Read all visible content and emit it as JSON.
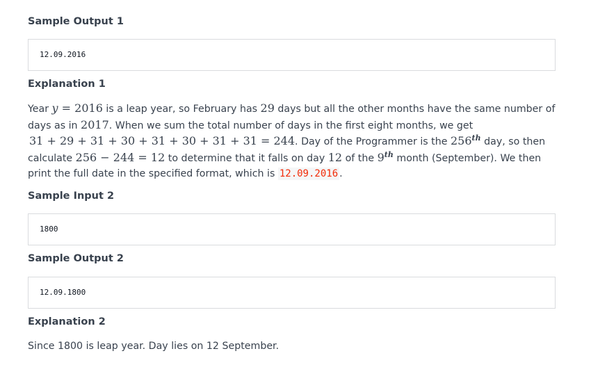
{
  "sample_output_1": {
    "heading": "Sample Output 1",
    "value": "12.09.2016"
  },
  "explanation_1": {
    "heading": "Explanation 1",
    "t1": "Year ",
    "m_y": "y",
    "m_eq2016": " = 2016",
    "t2": " is a leap year, so February has ",
    "m_29": "29",
    "t3": " days but all the other months have the same number of days as in ",
    "m_2017": "2017",
    "t4": ". When we sum the total number of days in the first eight months, we get ",
    "m_sum": "31 + 29 + 31 + 30 + 31 + 30 + 31 + 31 = 244",
    "t5": ". Day of the Programmer is the ",
    "m_256": "256",
    "m_th1": "th",
    "t6": " day, so then calculate ",
    "m_diff": "256 − 244 = 12",
    "t7": " to determine that it falls on day ",
    "m_12": "12",
    "t8": " of the ",
    "m_9": "9",
    "m_th2": "th",
    "t9": " month (September). We then print the full date in the specified format, which is ",
    "highlight": "12.09.2016",
    "t10": "."
  },
  "sample_input_2": {
    "heading": "Sample Input 2",
    "value": "1800"
  },
  "sample_output_2": {
    "heading": "Sample Output 2",
    "value": "12.09.1800"
  },
  "explanation_2": {
    "heading": "Explanation 2",
    "text": "Since 1800 is leap year. Day lies on 12 September."
  },
  "colors": {
    "text": "#39424e",
    "highlight": "#f22b08",
    "box_border": "#d9dbde"
  }
}
